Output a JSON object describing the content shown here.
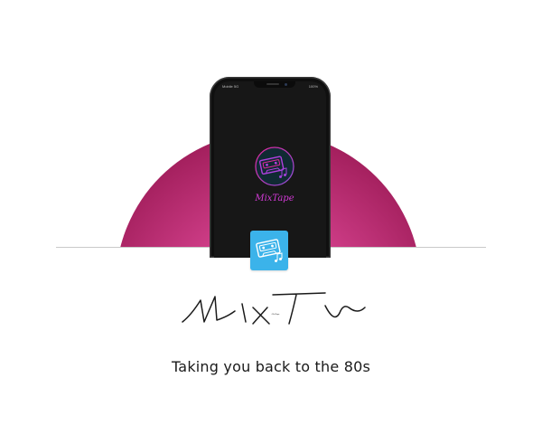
{
  "phone": {
    "status_bar": {
      "carrier": "Mobile 5G",
      "battery": "100%"
    },
    "screen_logo_icon": "cassette-tape-icon",
    "screen_logo_text": "MixTape"
  },
  "app_icon": "cassette-tape-icon",
  "brand": {
    "wordmark": "MixTape"
  },
  "tagline": "Taking you back to the 80s",
  "colors": {
    "backdrop_magenta": "#d13f8a",
    "neon_pink": "#e0279c",
    "neon_purple": "#8a4fd6",
    "icon_blue": "#3bb3ea",
    "text_dark": "#1a1a1a"
  }
}
